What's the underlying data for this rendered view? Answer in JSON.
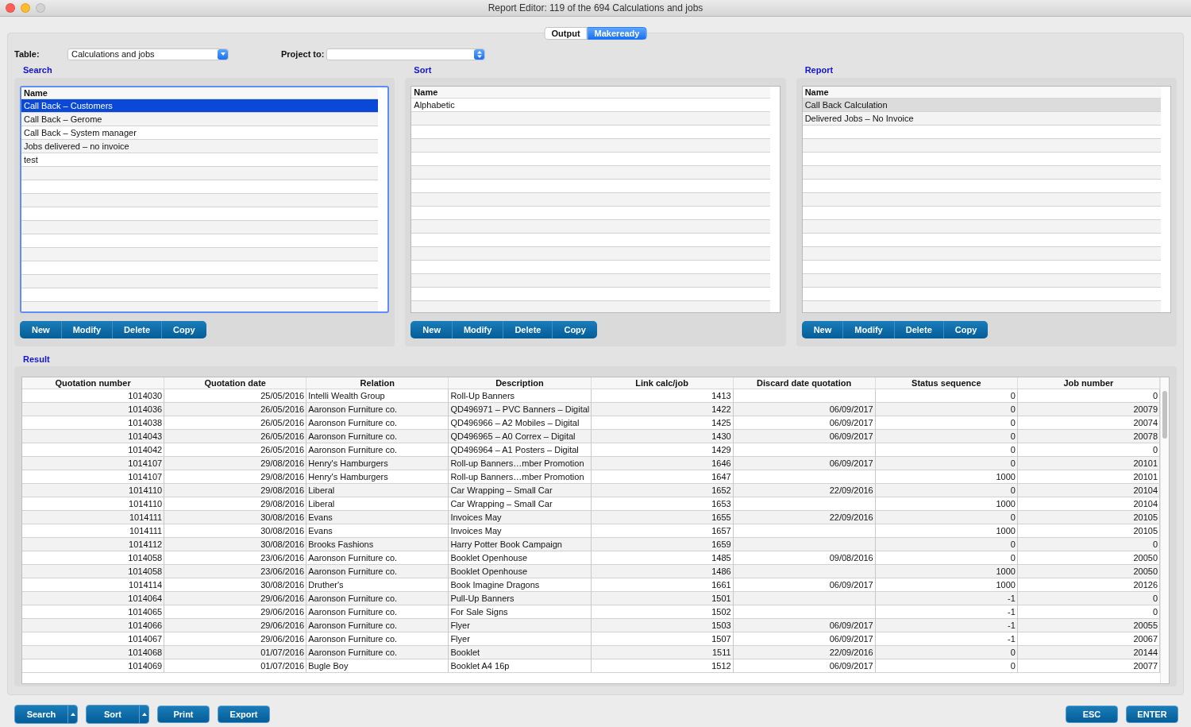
{
  "window": {
    "title": "Report Editor: 119 of the 694 Calculations and jobs"
  },
  "view_tabs": [
    {
      "label": "Output",
      "selected": false
    },
    {
      "label": "Makeready",
      "selected": true
    }
  ],
  "table_select": {
    "label": "Table:",
    "value": "Calculations and jobs"
  },
  "project_select": {
    "label": "Project to:"
  },
  "panels": [
    {
      "title": "Search",
      "column": "Name",
      "focused": true,
      "items": [
        {
          "name": "Call Back – Customers",
          "selected": true
        },
        {
          "name": "Call Back – Gerome",
          "selected": false
        },
        {
          "name": "Call Back – System manager",
          "selected": false
        },
        {
          "name": "Jobs delivered – no invoice",
          "selected": false
        },
        {
          "name": "test",
          "selected": false
        }
      ],
      "buttons": [
        "New",
        "Modify",
        "Delete",
        "Copy"
      ]
    },
    {
      "title": "Sort",
      "column": "Name",
      "focused": false,
      "items": [
        {
          "name": "Alphabetic",
          "selected": false
        }
      ],
      "buttons": [
        "New",
        "Modify",
        "Delete",
        "Copy"
      ]
    },
    {
      "title": "Report",
      "column": "Name",
      "focused": false,
      "items": [
        {
          "name": "Call Back Calculation",
          "selected": true
        },
        {
          "name": "Delivered Jobs – No Invoice",
          "selected": false
        }
      ],
      "buttons": [
        "New",
        "Modify",
        "Delete",
        "Copy"
      ]
    }
  ],
  "result": {
    "title": "Result",
    "columns": [
      {
        "label": "Quotation number"
      },
      {
        "label": "Quotation date"
      },
      {
        "label": "Relation"
      },
      {
        "label": "Description"
      },
      {
        "label": "Link calc/job"
      },
      {
        "label": "Discard date quotation"
      },
      {
        "label": "Status sequence"
      },
      {
        "label": "Job number"
      }
    ],
    "rows": [
      [
        "1014030",
        "25/05/2016",
        "Intelli Wealth Group",
        "Roll-Up Banners",
        "1413",
        null,
        "0",
        "0"
      ],
      [
        "1014036",
        "26/05/2016",
        "Aaronson Furniture co.",
        "QD496971 – PVC Banners – Digital",
        "1422",
        "06/09/2017",
        "0",
        "20079"
      ],
      [
        "1014038",
        "26/05/2016",
        "Aaronson Furniture co.",
        "QD496966 – A2 Mobiles – Digital",
        "1425",
        "06/09/2017",
        "0",
        "20074"
      ],
      [
        "1014043",
        "26/05/2016",
        "Aaronson Furniture co.",
        "QD496965 – A0 Correx – Digital",
        "1430",
        "06/09/2017",
        "0",
        "20078"
      ],
      [
        "1014042",
        "26/05/2016",
        "Aaronson Furniture co.",
        "QD496964 – A1 Posters – Digital",
        "1429",
        null,
        "0",
        "0"
      ],
      [
        "1014107",
        "29/08/2016",
        "Henry's Hamburgers",
        "Roll-up Banners…mber Promotion",
        "1646",
        "06/09/2017",
        "0",
        "20101"
      ],
      [
        "1014107",
        "29/08/2016",
        "Henry's Hamburgers",
        "Roll-up Banners…mber Promotion",
        "1647",
        null,
        "1000",
        "20101"
      ],
      [
        "1014110",
        "29/08/2016",
        "Liberal",
        "Car Wrapping – Small Car",
        "1652",
        "22/09/2016",
        "0",
        "20104"
      ],
      [
        "1014110",
        "29/08/2016",
        "Liberal",
        "Car Wrapping – Small Car",
        "1653",
        null,
        "1000",
        "20104"
      ],
      [
        "1014111",
        "30/08/2016",
        "Evans",
        "Invoices May",
        "1655",
        "22/09/2016",
        "0",
        "20105"
      ],
      [
        "1014111",
        "30/08/2016",
        "Evans",
        "Invoices May",
        "1657",
        null,
        "1000",
        "20105"
      ],
      [
        "1014112",
        "30/08/2016",
        "Brooks Fashions",
        "Harry Potter Book Campaign",
        "1659",
        null,
        "0",
        "0"
      ],
      [
        "1014058",
        "23/06/2016",
        "Aaronson Furniture co.",
        "Booklet Openhouse",
        "1485",
        "09/08/2016",
        "0",
        "20050"
      ],
      [
        "1014058",
        "23/06/2016",
        "Aaronson Furniture co.",
        "Booklet Openhouse",
        "1486",
        null,
        "1000",
        "20050"
      ],
      [
        "1014114",
        "30/08/2016",
        "Druther's",
        "Book Imagine Dragons",
        "1661",
        "06/09/2017",
        "1000",
        "20126"
      ],
      [
        "1014064",
        "29/06/2016",
        "Aaronson Furniture co.",
        "Pull-Up Banners",
        "1501",
        null,
        "-1",
        "0"
      ],
      [
        "1014065",
        "29/06/2016",
        "Aaronson Furniture co.",
        "For Sale Signs",
        "1502",
        null,
        "-1",
        "0"
      ],
      [
        "1014066",
        "29/06/2016",
        "Aaronson Furniture co.",
        "Flyer",
        "1503",
        "06/09/2017",
        "-1",
        "20055"
      ],
      [
        "1014067",
        "29/06/2016",
        "Aaronson Furniture co.",
        "Flyer",
        "1507",
        "06/09/2017",
        "-1",
        "20067"
      ],
      [
        "1014068",
        "01/07/2016",
        "Aaronson Furniture co.",
        "Booklet",
        "1511",
        "22/09/2016",
        "0",
        "20144"
      ],
      [
        "1014069",
        "01/07/2016",
        "Bugle Boy",
        "Booklet A4 16p",
        "1512",
        "06/09/2017",
        "0",
        "20077"
      ]
    ]
  },
  "footer": {
    "left_buttons": [
      {
        "label": "Search",
        "menu": true
      },
      {
        "label": "Sort",
        "menu": true
      },
      {
        "label": "Print",
        "menu": false
      },
      {
        "label": "Export",
        "menu": false
      }
    ],
    "right_buttons": [
      "ESC",
      "ENTER"
    ]
  }
}
